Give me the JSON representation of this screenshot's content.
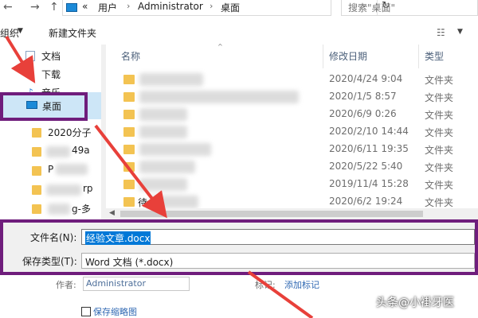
{
  "address_bar": {
    "back": "←",
    "forward": "→",
    "overflow": "«",
    "crumbs": [
      "用户",
      "Administrator",
      "桌面"
    ],
    "separator": "›",
    "dropdown": "⌄",
    "refresh": "↻",
    "search_placeholder": "搜索\"桌面\""
  },
  "toolbar": {
    "organize": "组织",
    "organize_dd": "▼",
    "new_folder": "新建文件夹",
    "view": "☷",
    "view_dd": "▼"
  },
  "nav": {
    "items": [
      {
        "label": "文档",
        "icon": "document-icon"
      },
      {
        "label": "下载",
        "icon": "download-icon"
      },
      {
        "label": "音乐",
        "icon": "music-icon"
      }
    ],
    "selected": "桌面",
    "folders": [
      {
        "label": "2020分子"
      },
      {
        "label": "49a"
      },
      {
        "label": "P"
      },
      {
        "label": "rp"
      },
      {
        "label": "g-多"
      }
    ]
  },
  "file_list": {
    "columns": {
      "name": "名称",
      "date": "修改日期",
      "type": "类型"
    },
    "sort_indicator": "^",
    "rows": [
      {
        "name": "",
        "date": "2020/4/24 9:04",
        "type": "文件夹"
      },
      {
        "name": "",
        "date": "2020/1/5 8:57",
        "type": "文件夹"
      },
      {
        "name": "",
        "date": "2020/6/9 0:26",
        "type": "文件夹"
      },
      {
        "name": "",
        "date": "2020/2/10 14:44",
        "type": "文件夹"
      },
      {
        "name": "",
        "date": "2020/6/11 19:35",
        "type": "文件夹"
      },
      {
        "name": "",
        "date": "2020/5/22 5:40",
        "type": "文件夹"
      },
      {
        "name": "",
        "date": "2019/11/4 15:28",
        "type": "文件夹"
      },
      {
        "name": "待",
        "date": "2020/6/2 19:24",
        "type": "文件夹"
      }
    ],
    "scroll_left": "◀"
  },
  "form": {
    "filename_label": "文件名(N):",
    "filename_value": "经验文章.docx",
    "filetype_label": "保存类型(T):",
    "filetype_value": "Word 文档 (*.docx)"
  },
  "meta": {
    "author_label": "作者:",
    "author_value": "Administrator",
    "tags_label": "标记:",
    "tags_link": "添加标记",
    "thumbnail_label": "保存缩略图"
  },
  "watermark": "头条@小褂牙医",
  "colors": {
    "highlight": "#6f1d7c",
    "arrow": "#e8403a",
    "selection": "#0078d7",
    "folder": "#f3c352"
  }
}
